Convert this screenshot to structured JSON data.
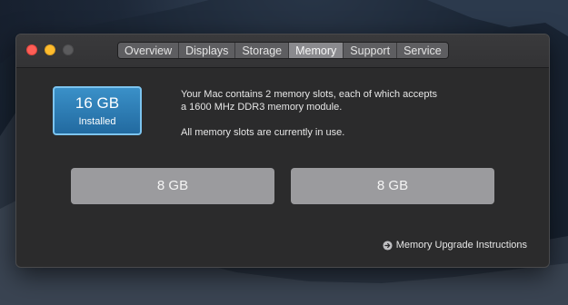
{
  "window": {
    "tabs": [
      {
        "label": "Overview",
        "active": false
      },
      {
        "label": "Displays",
        "active": false
      },
      {
        "label": "Storage",
        "active": false
      },
      {
        "label": "Memory",
        "active": true
      },
      {
        "label": "Support",
        "active": false
      },
      {
        "label": "Service",
        "active": false
      }
    ]
  },
  "memory": {
    "installed_size": "16 GB",
    "installed_label": "Installed",
    "description_line1": "Your Mac contains 2 memory slots, each of which accepts",
    "description_line2": "a 1600 MHz DDR3 memory module.",
    "status": "All memory slots are currently in use.",
    "slots": [
      "8 GB",
      "8 GB"
    ],
    "upgrade_link": "Memory Upgrade Instructions",
    "upgrade_icon": "arrow-right-circle-icon"
  },
  "colors": {
    "accent": "#2f80bd",
    "close": "#fe5f57",
    "minimize": "#febc2e"
  }
}
